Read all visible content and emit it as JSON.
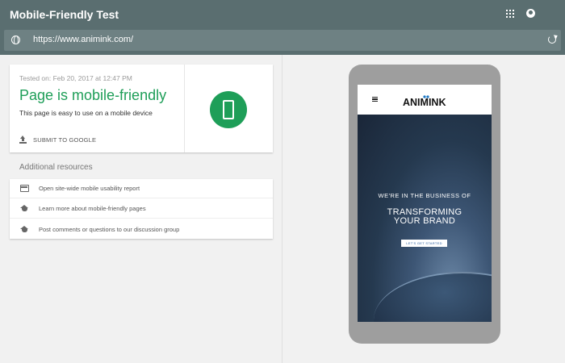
{
  "app": {
    "title": "Mobile-Friendly Test"
  },
  "topbar": {
    "apps_icon": "apps-grid-icon",
    "account_icon": "account-icon"
  },
  "urlbar": {
    "url": "https://www.animink.com/",
    "globe_icon": "globe-icon",
    "refresh_icon": "refresh-icon"
  },
  "result": {
    "tested_on": "Tested on: Feb 20, 2017 at 12:47 PM",
    "headline": "Page is mobile-friendly",
    "description": "This page is easy to use on a mobile device",
    "submit_label": "SUBMIT TO GOOGLE",
    "status_color": "#1e9e58",
    "badge_icon": "smartphone-icon"
  },
  "resources": {
    "heading": "Additional resources",
    "items": [
      {
        "label": "Open site-wide mobile usability report",
        "icon": "web-icon"
      },
      {
        "label": "Learn more about mobile-friendly pages",
        "icon": "school-icon"
      },
      {
        "label": "Post comments or questions to our discussion group",
        "icon": "school-icon"
      }
    ]
  },
  "preview": {
    "logo_text": "ANIMINK",
    "hero_line1": "WE'RE IN THE BUSINESS OF",
    "hero_line2a": "TRANSFORMING",
    "hero_line2b": "YOUR BRAND",
    "cta": "LET'S GET STARTED",
    "menu_icon": "hamburger-menu-icon"
  }
}
